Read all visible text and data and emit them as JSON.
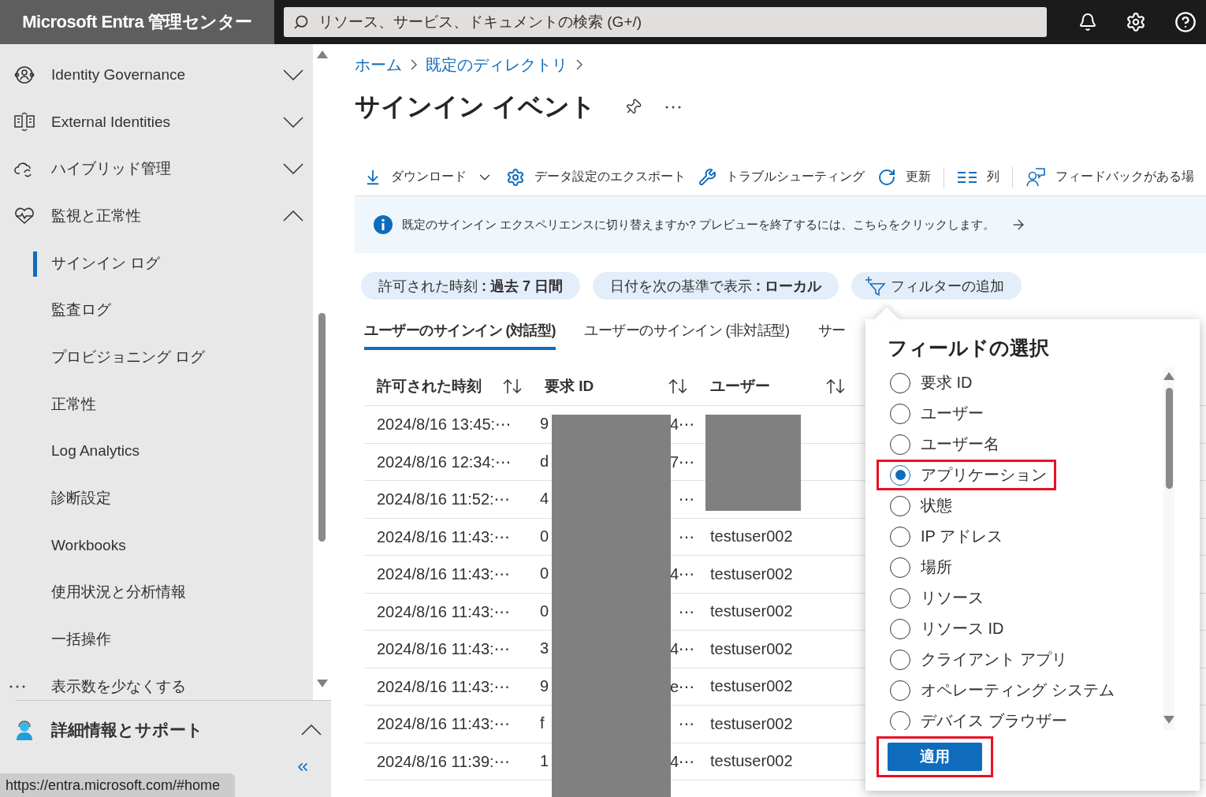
{
  "header": {
    "brand": "Microsoft Entra 管理センター",
    "search_placeholder": "リソース、サービス、ドキュメントの検索 (G+/)"
  },
  "sidebar": {
    "groups": [
      {
        "label": "Identity Governance",
        "expanded": false
      },
      {
        "label": "External Identities",
        "expanded": false
      },
      {
        "label": "ハイブリッド管理",
        "expanded": false
      },
      {
        "label": "監視と正常性",
        "expanded": true,
        "children": [
          {
            "label": "サインイン ログ",
            "selected": true
          },
          {
            "label": "監査ログ",
            "selected": false
          },
          {
            "label": "プロビジョニング ログ",
            "selected": false
          },
          {
            "label": "正常性",
            "selected": false
          },
          {
            "label": "Log Analytics",
            "selected": false
          },
          {
            "label": "診断設定",
            "selected": false
          },
          {
            "label": "Workbooks",
            "selected": false
          },
          {
            "label": "使用状況と分析情報",
            "selected": false
          },
          {
            "label": "一括操作",
            "selected": false
          }
        ]
      }
    ],
    "show_less": "表示数を少なくする",
    "support": {
      "label": "詳細情報とサポート",
      "expanded": true
    }
  },
  "breadcrumb": [
    "ホーム",
    "既定のディレクトリ"
  ],
  "title": "サインイン イベント",
  "toolbar": [
    {
      "kind": "download",
      "label": "ダウンロード"
    },
    {
      "kind": "export",
      "label": "データ設定のエクスポート"
    },
    {
      "kind": "troubleshoot",
      "label": "トラブルシューティング"
    },
    {
      "kind": "refresh",
      "label": "更新"
    },
    {
      "kind": "separator"
    },
    {
      "kind": "columns",
      "label": "列"
    },
    {
      "kind": "separator"
    },
    {
      "kind": "feedback",
      "label": "フィードバックがある場"
    }
  ],
  "banner": "既定のサインイン エクスペリエンスに切り替えますか? プレビューを終了するには、こちらをクリックします。",
  "filters": [
    {
      "kind": "value",
      "text": "許可された時刻 **: 過去 7 日間**"
    },
    {
      "kind": "value",
      "text": "日付を次の基準で表示 **: ローカル**"
    },
    {
      "kind": "add",
      "text": "フィルターの追加"
    }
  ],
  "tabs": [
    {
      "label": "ユーザーのサインイン (対話型)",
      "selected": true
    },
    {
      "label": "ユーザーのサインイン (非対話型)",
      "selected": false
    },
    {
      "label": "サー",
      "selected": false
    }
  ],
  "table": {
    "columns": [
      "許可された時刻",
      "要求 ID",
      "ユーザー"
    ],
    "rows": [
      {
        "time": "2024/8/16 13:45:⋯",
        "request_start": "9",
        "request_end": "4⋯"
      },
      {
        "time": "2024/8/16 12:34:⋯",
        "request_start": "d",
        "request_end": "7⋯"
      },
      {
        "time": "2024/8/16 11:52:⋯",
        "request_start": "4",
        "request_end": "⋯"
      },
      {
        "time": "2024/8/16 11:43:⋯",
        "request_start": "0",
        "request_end": "⋯",
        "user": "testuser002"
      },
      {
        "time": "2024/8/16 11:43:⋯",
        "request_start": "0",
        "request_end": "4⋯",
        "user": "testuser002"
      },
      {
        "time": "2024/8/16 11:43:⋯",
        "request_start": "0",
        "request_end": "⋯",
        "user": "testuser002"
      },
      {
        "time": "2024/8/16 11:43:⋯",
        "request_start": "3",
        "request_end": "4⋯",
        "user": "testuser002"
      },
      {
        "time": "2024/8/16 11:43:⋯",
        "request_start": "9",
        "request_end": "e⋯",
        "user": "testuser002"
      },
      {
        "time": "2024/8/16 11:43:⋯",
        "request_start": "f",
        "request_end": "⋯",
        "user": "testuser002"
      },
      {
        "time": "2024/8/16 11:39:⋯",
        "request_start": "1",
        "request_end": "4⋯",
        "user": "testuser002"
      }
    ]
  },
  "field_picker": {
    "title": "フィールドの選択",
    "options": [
      {
        "label": "要求 ID",
        "selected": false,
        "highlighted": false
      },
      {
        "label": "ユーザー",
        "selected": false,
        "highlighted": false
      },
      {
        "label": "ユーザー名",
        "selected": false,
        "highlighted": false
      },
      {
        "label": "アプリケーション",
        "selected": true,
        "highlighted": true
      },
      {
        "label": "状態",
        "selected": false,
        "highlighted": false
      },
      {
        "label": "IP アドレス",
        "selected": false,
        "highlighted": false
      },
      {
        "label": "場所",
        "selected": false,
        "highlighted": false
      },
      {
        "label": "リソース",
        "selected": false,
        "highlighted": false
      },
      {
        "label": "リソース ID",
        "selected": false,
        "highlighted": false
      },
      {
        "label": "クライアント アプリ",
        "selected": false,
        "highlighted": false
      },
      {
        "label": "オペレーティング システム",
        "selected": false,
        "highlighted": false
      },
      {
        "label": "デバイス ブラウザー",
        "selected": false,
        "highlighted": false
      }
    ],
    "apply": {
      "label": "適用",
      "highlighted": true
    }
  },
  "status_url": "https://entra.microsoft.com/#home"
}
